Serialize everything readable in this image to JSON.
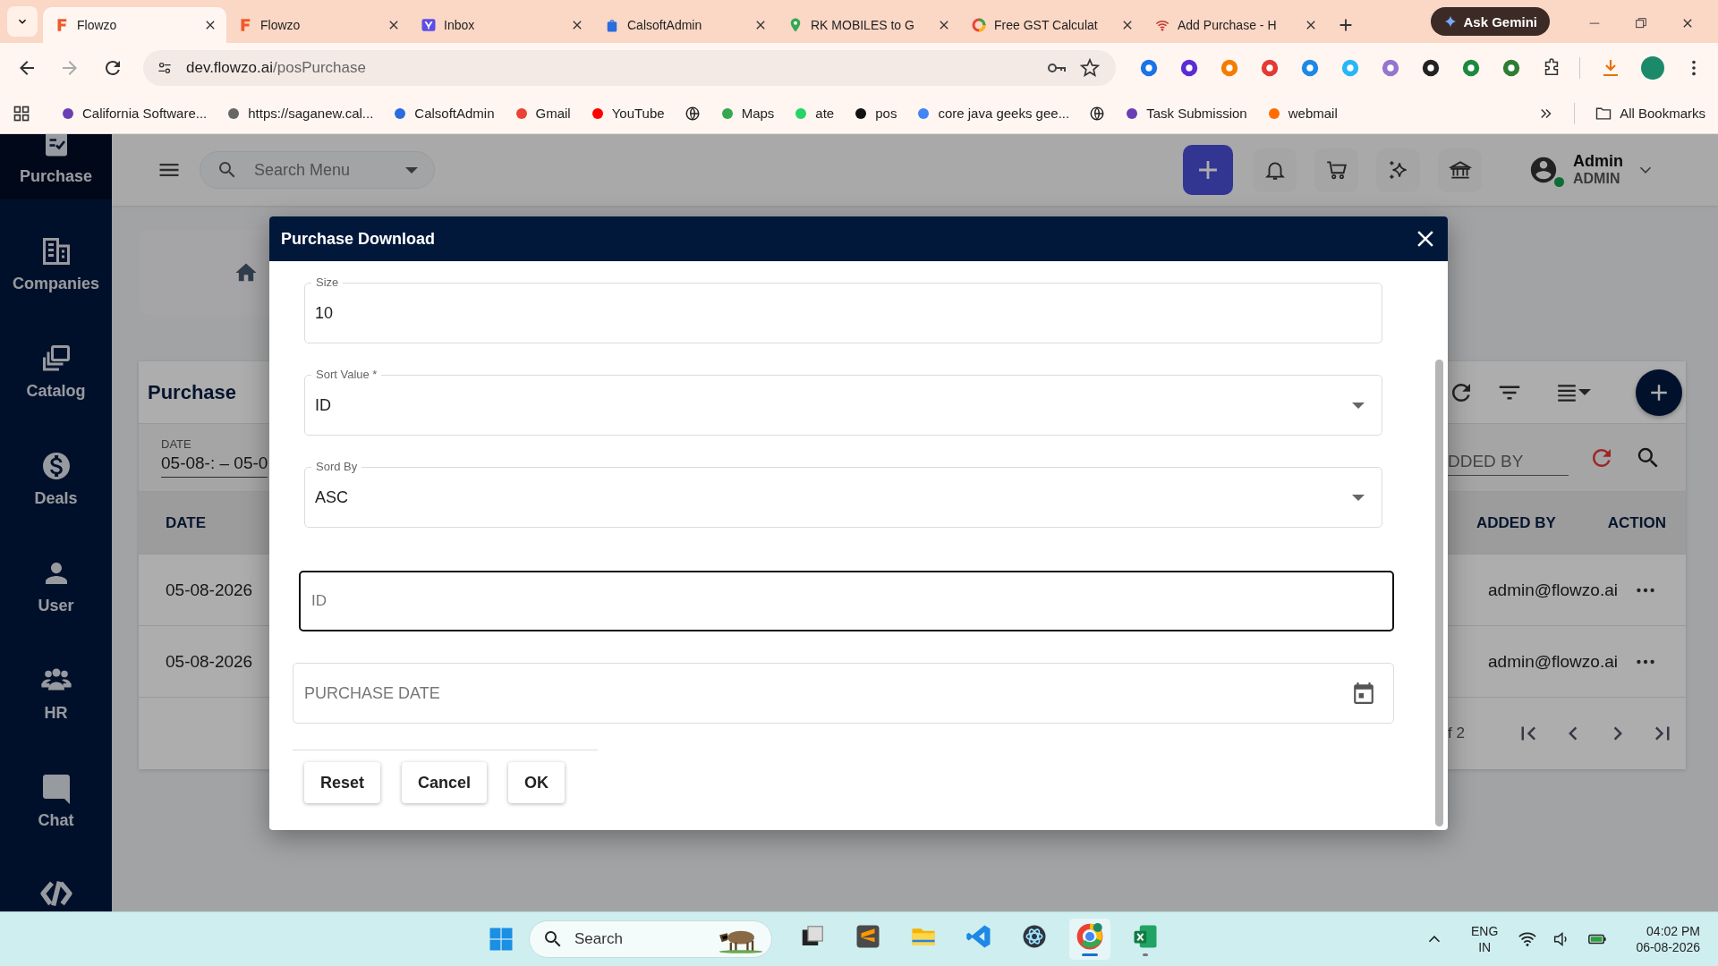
{
  "browser": {
    "tabs": [
      {
        "title": "Flowzo",
        "selected": true
      },
      {
        "title": "Flowzo",
        "selected": false
      },
      {
        "title": "Inbox",
        "selected": false
      },
      {
        "title": "CalsoftAdmin",
        "selected": false
      },
      {
        "title": "RK MOBILES to G",
        "selected": false
      },
      {
        "title": "Free GST Calculat",
        "selected": false
      },
      {
        "title": "Add Purchase - H",
        "selected": false
      }
    ],
    "gemini_button": "Ask Gemini",
    "address": {
      "host": "dev.flowzo.ai",
      "path": "/posPurchase"
    },
    "bookmarks": [
      {
        "kind": "link",
        "label": "California Software..."
      },
      {
        "kind": "link",
        "label": "https://saganew.cal..."
      },
      {
        "kind": "link",
        "label": "CalsoftAdmin"
      },
      {
        "kind": "link",
        "label": "Gmail"
      },
      {
        "kind": "link",
        "label": "YouTube"
      },
      {
        "kind": "icon"
      },
      {
        "kind": "link",
        "label": "Maps"
      },
      {
        "kind": "link",
        "label": "ate"
      },
      {
        "kind": "link",
        "label": "pos"
      },
      {
        "kind": "link",
        "label": "core java geeks gee..."
      },
      {
        "kind": "icon"
      },
      {
        "kind": "link",
        "label": "Task Submission"
      },
      {
        "kind": "link",
        "label": "webmail"
      }
    ],
    "all_bookmarks": "All Bookmarks"
  },
  "sidebar": {
    "items": [
      {
        "label": "Purchase",
        "selected": true
      },
      {
        "label": "Companies",
        "selected": false
      },
      {
        "label": "Catalog",
        "selected": false
      },
      {
        "label": "Deals",
        "selected": false
      },
      {
        "label": "User",
        "selected": false
      },
      {
        "label": "HR",
        "selected": false
      },
      {
        "label": "Chat",
        "selected": false
      }
    ]
  },
  "header": {
    "search_placeholder": "Search Menu",
    "user_name": "Admin",
    "user_role": "ADMIN"
  },
  "page": {
    "title": "Purchase",
    "date_filter_label": "DATE",
    "date_filter_value": "05-08-: – 05-0",
    "added_by_filter": "DDED BY",
    "left_columns": [
      "DATE"
    ],
    "right_columns": [
      "ADDED BY",
      "ACTION"
    ],
    "rows": [
      {
        "date": "05-08-2026",
        "added_by": "admin@flowzo.ai"
      },
      {
        "date": "05-08-2026",
        "added_by": "admin@flowzo.ai"
      }
    ],
    "pagination": "f 2"
  },
  "dialog": {
    "title": "Purchase Download",
    "fields": [
      {
        "kind": "text",
        "label": "Size",
        "value": "10",
        "focused": false
      },
      {
        "kind": "select",
        "label": "Sort Value *",
        "value": "ID",
        "focused": false
      },
      {
        "kind": "select",
        "label": "Sord By",
        "value": "ASC",
        "focused": false
      },
      {
        "kind": "text",
        "placeholder": "ID",
        "focused": true
      },
      {
        "kind": "date",
        "placeholder": "PURCHASE DATE",
        "focused": false
      }
    ],
    "buttons": [
      "Reset",
      "Cancel",
      "OK"
    ]
  },
  "taskbar": {
    "search_placeholder": "Search",
    "apps": [
      {
        "active": false,
        "running": false
      },
      {
        "active": false,
        "running": false
      },
      {
        "active": false,
        "running": false
      },
      {
        "active": false,
        "running": false
      },
      {
        "active": false,
        "running": false
      },
      {
        "active": true,
        "running": true
      },
      {
        "active": false,
        "running": true
      }
    ],
    "language": "ENG",
    "region": "IN",
    "time": "04:02 PM",
    "date": "06-08-2026"
  }
}
